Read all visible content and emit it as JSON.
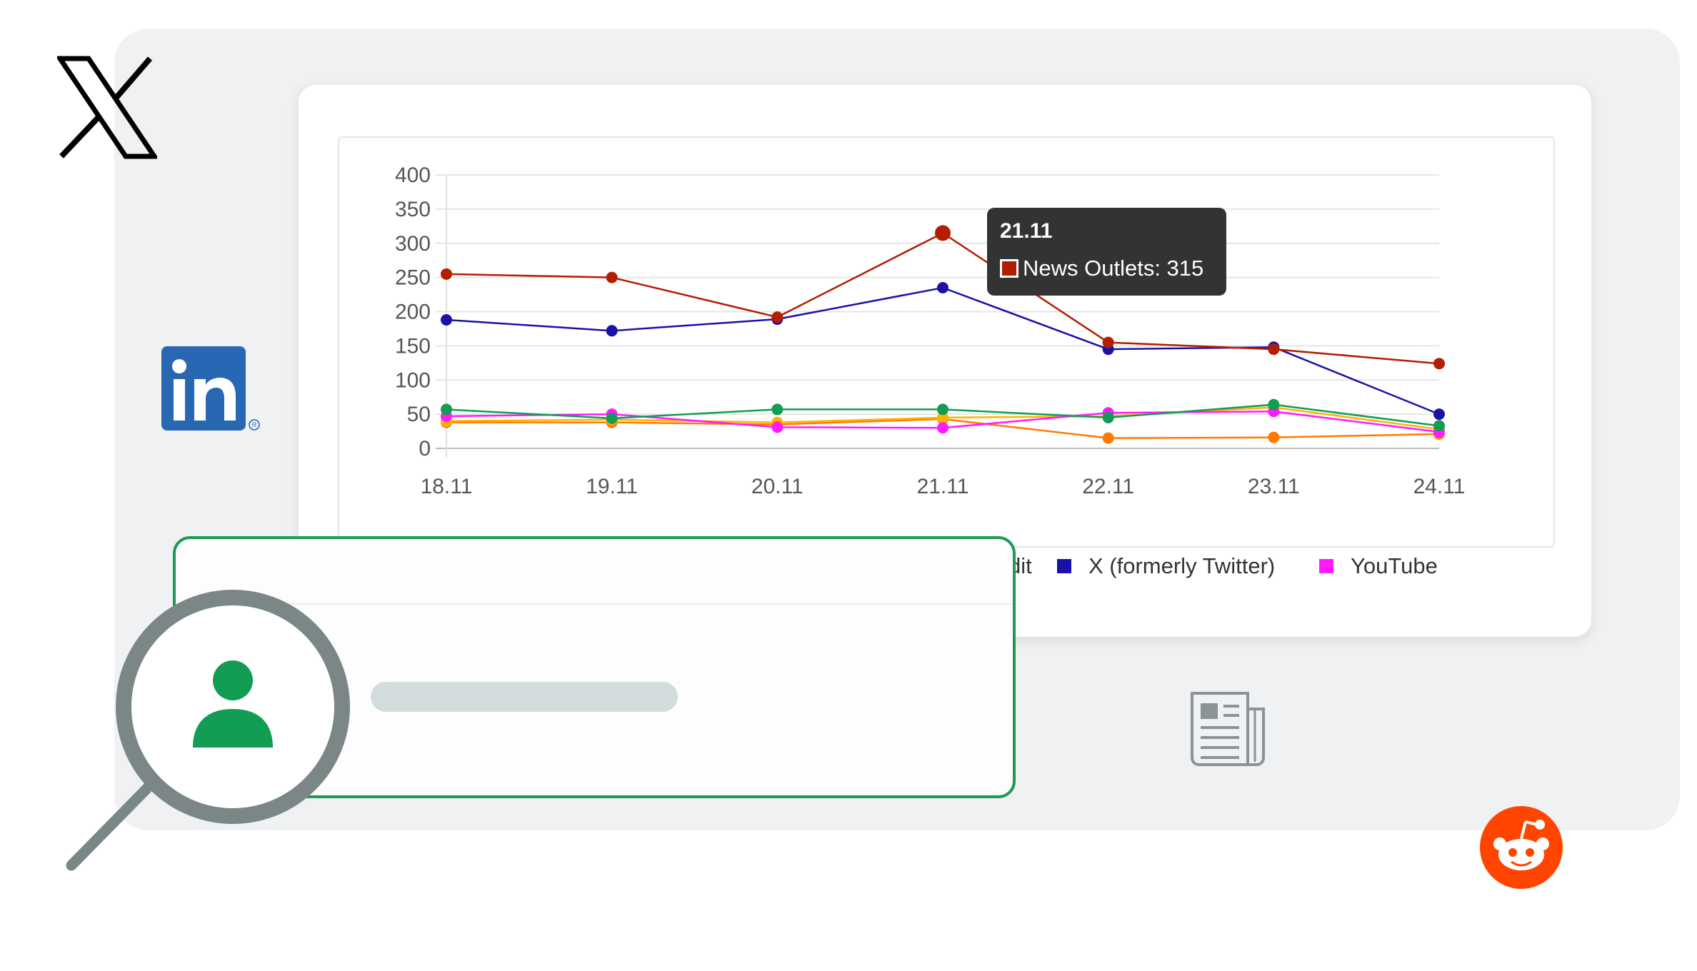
{
  "tooltip": {
    "title": "21.11",
    "text": "News Outlets: 315"
  },
  "legend": [
    {
      "label": "dit",
      "color": ""
    },
    {
      "label": "X (formerly Twitter)",
      "color": "#1a12a8"
    },
    {
      "label": "YouTube",
      "color": "#ff1aff"
    }
  ],
  "icons": {
    "x_logo": "x-logo-icon",
    "linkedin_logo": "linkedin-logo-icon",
    "newspaper": "newspaper-icon",
    "reddit_logo": "reddit-logo-icon",
    "magnifier": "magnifying-glass-icon",
    "user": "user-icon"
  },
  "colors": {
    "accent_green": "#1e9a54",
    "panel_bg": "#eff1f2",
    "reddit_orange": "#ff4500",
    "linkedin_blue": "#2867b2"
  },
  "chart_data": {
    "type": "line",
    "categories": [
      "18.11",
      "19.11",
      "20.11",
      "21.11",
      "22.11",
      "23.11",
      "24.11"
    ],
    "ylim": [
      0,
      400
    ],
    "yticks": [
      0,
      50,
      100,
      150,
      200,
      250,
      300,
      350,
      400
    ],
    "grid": true,
    "series": [
      {
        "name": "News Outlets",
        "color": "#b31e00",
        "values": [
          255,
          250,
          192,
          315,
          155,
          145,
          124
        ]
      },
      {
        "name": "X (formerly Twitter)",
        "color": "#1a12a8",
        "values": [
          188,
          172,
          189,
          235,
          145,
          148,
          50
        ]
      },
      {
        "color": "#129c54",
        "values": [
          57,
          44,
          57,
          57,
          45,
          64,
          33
        ]
      },
      {
        "name": "YouTube",
        "color": "#ff1aff",
        "values": [
          47,
          50,
          31,
          30,
          52,
          54,
          24
        ]
      },
      {
        "color": "#ffb300",
        "values": [
          40,
          42,
          38,
          45,
          47,
          60,
          28
        ]
      },
      {
        "color": "#ff7a00",
        "values": [
          38,
          38,
          35,
          43,
          15,
          16,
          21
        ]
      }
    ]
  }
}
